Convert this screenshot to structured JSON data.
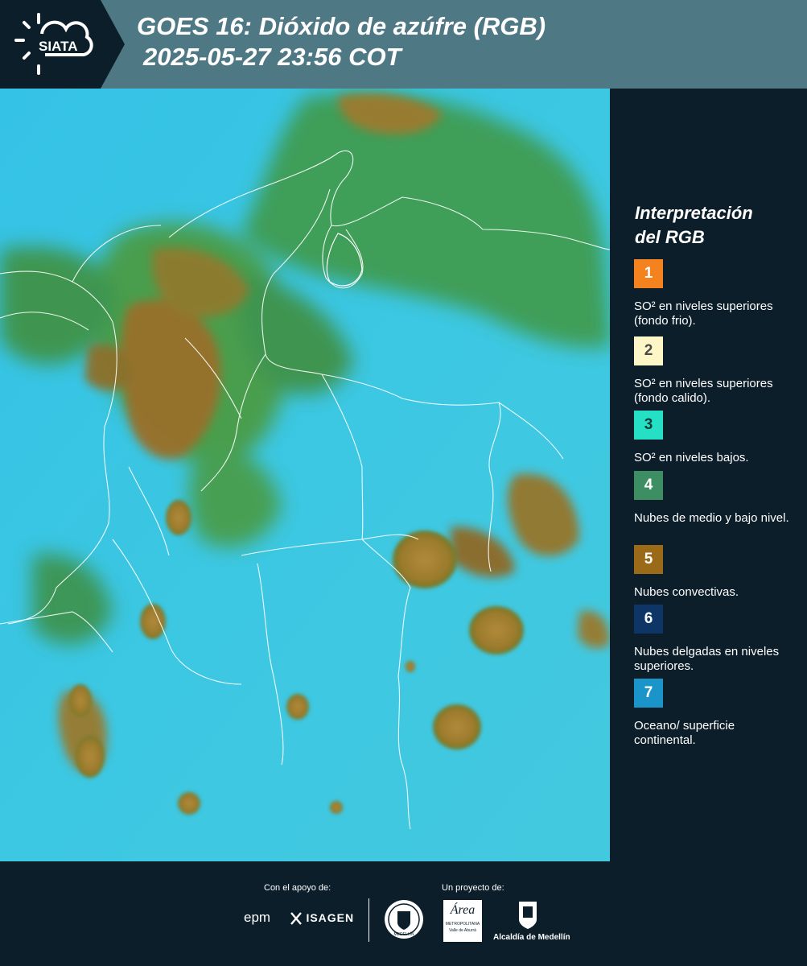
{
  "header": {
    "brand": "SIATA",
    "title_line1": "GOES 16: Dióxido de azúfre (RGB)",
    "title_line2": "2025-05-27 23:56 COT"
  },
  "map": {
    "description_icon": "satellite-rgb-map"
  },
  "legend": {
    "title_line1": "Interpretación",
    "title_line2": "del RGB",
    "items": [
      {
        "num": "1",
        "label": "SO² en niveles superiores (fondo frio).",
        "color": "#f4821e",
        "textcolor": "#ffffff"
      },
      {
        "num": "2",
        "label": "SO² en niveles superiores (fondo calido).",
        "color": "#fdf6c6",
        "textcolor": "#4a4a4a"
      },
      {
        "num": "3",
        "label": "SO² en niveles bajos.",
        "color": "#25e0c5",
        "textcolor": "#0c3d3a"
      },
      {
        "num": "4",
        "label": "Nubes de medio y bajo nivel.",
        "color": "#3d8f63",
        "textcolor": "#ffffff"
      },
      {
        "num": "5",
        "label": "Nubes convectivas.",
        "color": "#9a6a18",
        "textcolor": "#ffffff"
      },
      {
        "num": "6",
        "label": "Nubes delgadas en niveles superiores.",
        "color": "#0d3566",
        "textcolor": "#ffffff"
      },
      {
        "num": "7",
        "label": "Oceano/ superficie continental.",
        "color": "#1b95c9",
        "textcolor": "#ffffff"
      }
    ]
  },
  "footer": {
    "support_label": "Con el apoyo de:",
    "project_label": "Un proyecto de:",
    "epm": "epm",
    "isagen": "ISAGEN",
    "area_brand": "Área",
    "area_sub": "METROPOLITANA",
    "area_sub2": "Valle de Aburrá",
    "alcaldia": "Alcaldía de Medellín",
    "medellin_seal": "MEDELLÍN"
  }
}
